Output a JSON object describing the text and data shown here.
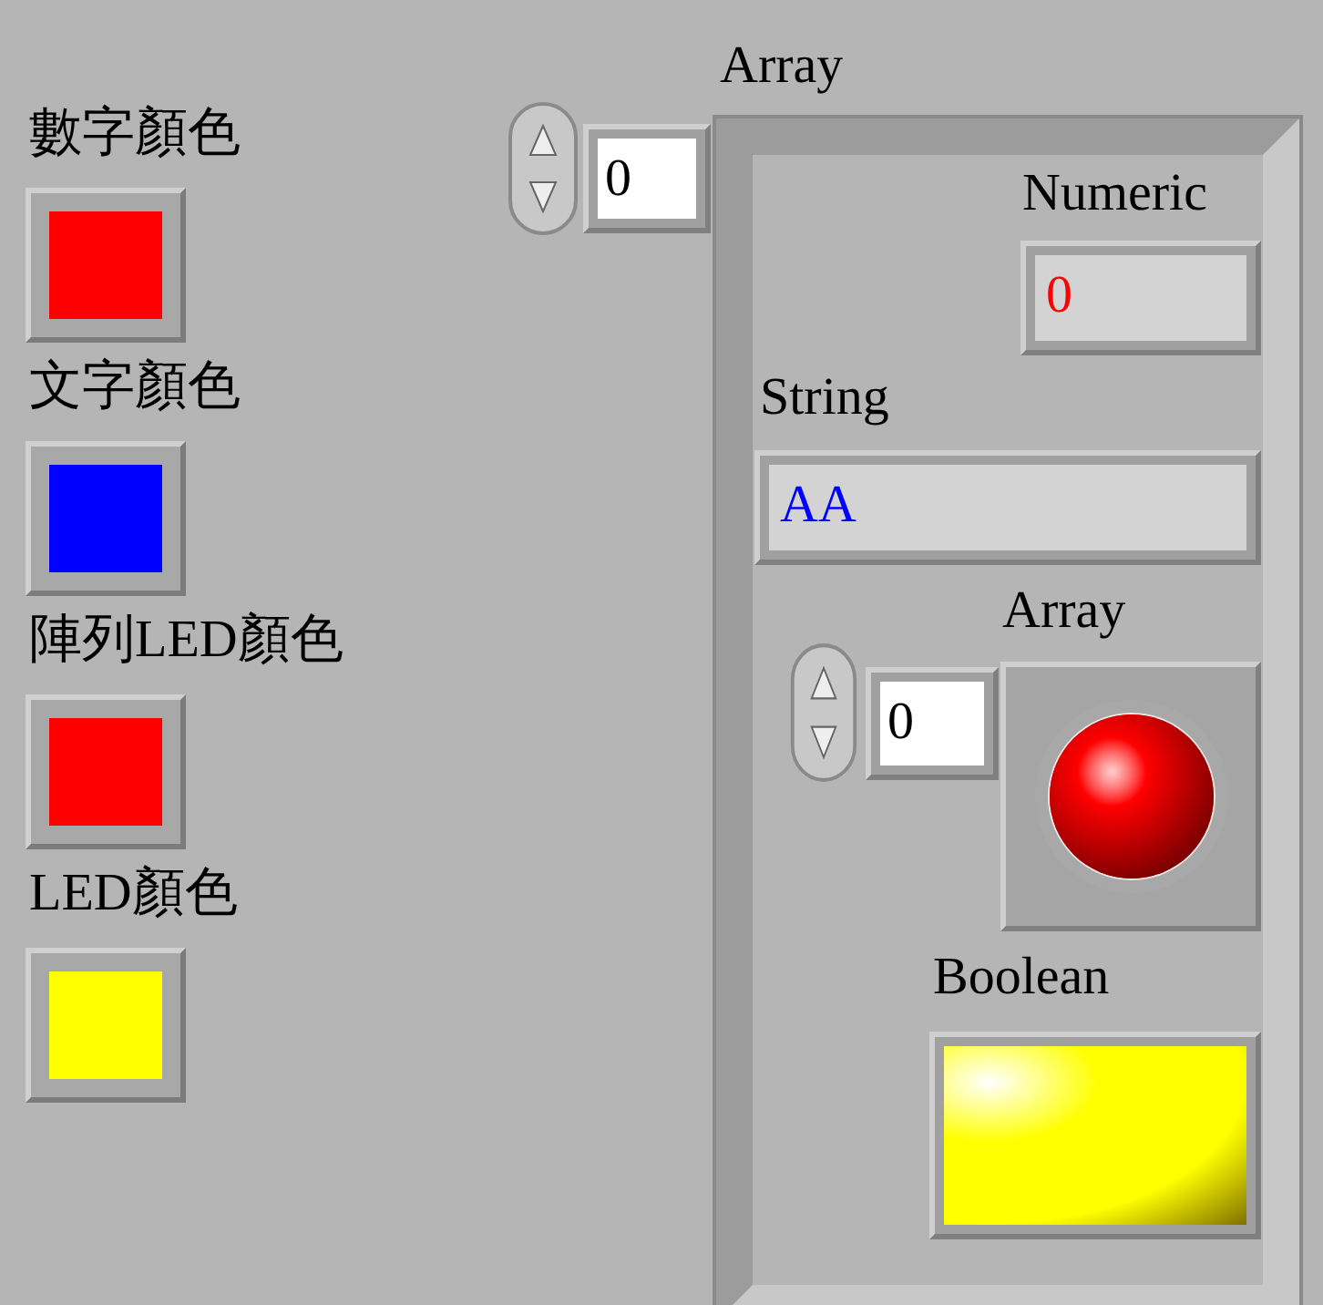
{
  "color_boxes": [
    {
      "label": "數字顏色",
      "color": "#ff0000"
    },
    {
      "label": "文字顏色",
      "color": "#0000ff"
    },
    {
      "label": "陣列LED顏色",
      "color": "#ff0000"
    },
    {
      "label": "LED顏色",
      "color": "#ffff00"
    }
  ],
  "array": {
    "label": "Array",
    "index": "0",
    "numeric": {
      "label": "Numeric",
      "value": "0",
      "color": "#ff0000"
    },
    "string": {
      "label": "String",
      "value": "AA",
      "color": "#0000ff"
    },
    "inner_array": {
      "label": "Array",
      "index": "0",
      "led": {
        "on": true,
        "color": "#ff0000"
      }
    },
    "boolean": {
      "label": "Boolean",
      "on": true,
      "color": "#ffff00"
    }
  }
}
